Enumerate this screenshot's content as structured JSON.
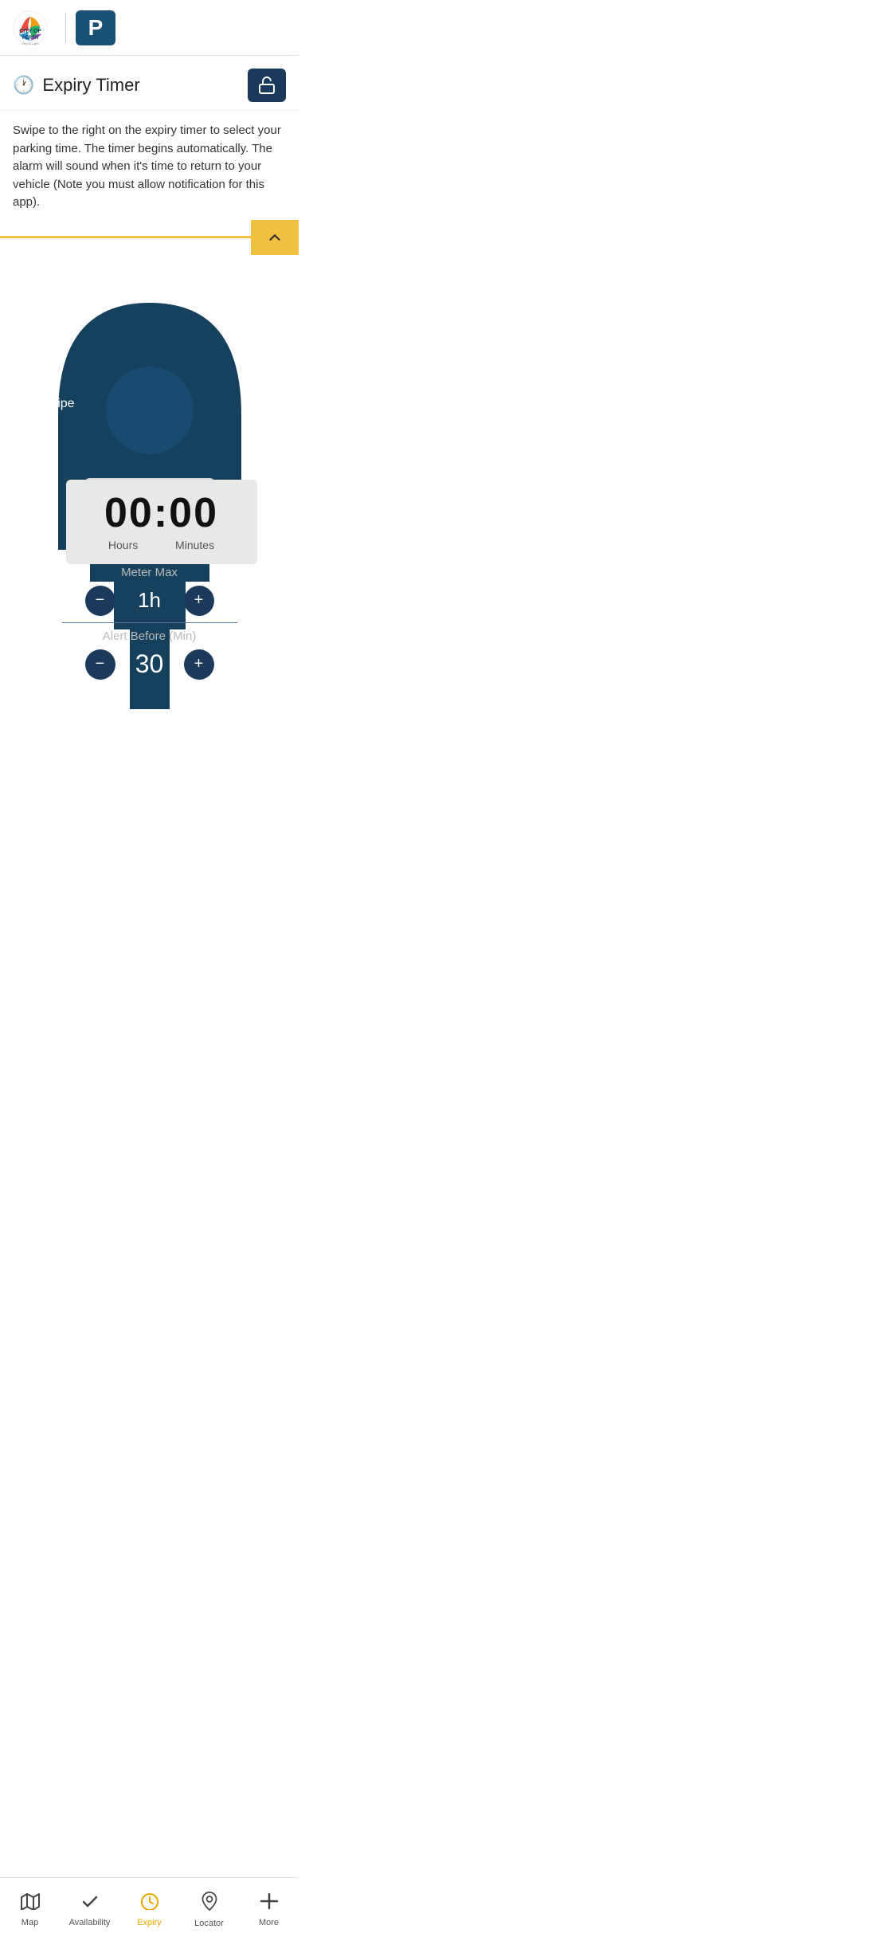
{
  "app": {
    "title": "City of Perth Parking"
  },
  "header": {
    "title": "Expiry Timer",
    "lock_btn_label": "Lock"
  },
  "description": {
    "text": "Swipe to the right on the expiry timer to select your parking time. The timer begins automatically. The alarm will sound when it's time to return to your vehicle (Note you must allow notification for this app)."
  },
  "timer": {
    "display": "00:00",
    "hours_label": "Hours",
    "minutes_label": "Minutes"
  },
  "meter_max": {
    "label": "Meter Max",
    "value": "1h",
    "decrement_label": "−",
    "increment_label": "+"
  },
  "alert": {
    "label": "Alert Before (Min)",
    "value": "30",
    "decrement_label": "−",
    "increment_label": "+"
  },
  "swipe": {
    "label": "Swipe"
  },
  "nav": {
    "items": [
      {
        "id": "map",
        "label": "Map",
        "icon": "map"
      },
      {
        "id": "availability",
        "label": "Availability",
        "icon": "check"
      },
      {
        "id": "expiry",
        "label": "Expiry",
        "icon": "clock",
        "active": true
      },
      {
        "id": "locator",
        "label": "Locator",
        "icon": "pin"
      },
      {
        "id": "more",
        "label": "More",
        "icon": "plus"
      }
    ]
  },
  "colors": {
    "brand_dark": "#1a3a5c",
    "brand_yellow": "#f0c040",
    "nav_active": "#f0a800",
    "meter_bg": "#15405e"
  }
}
